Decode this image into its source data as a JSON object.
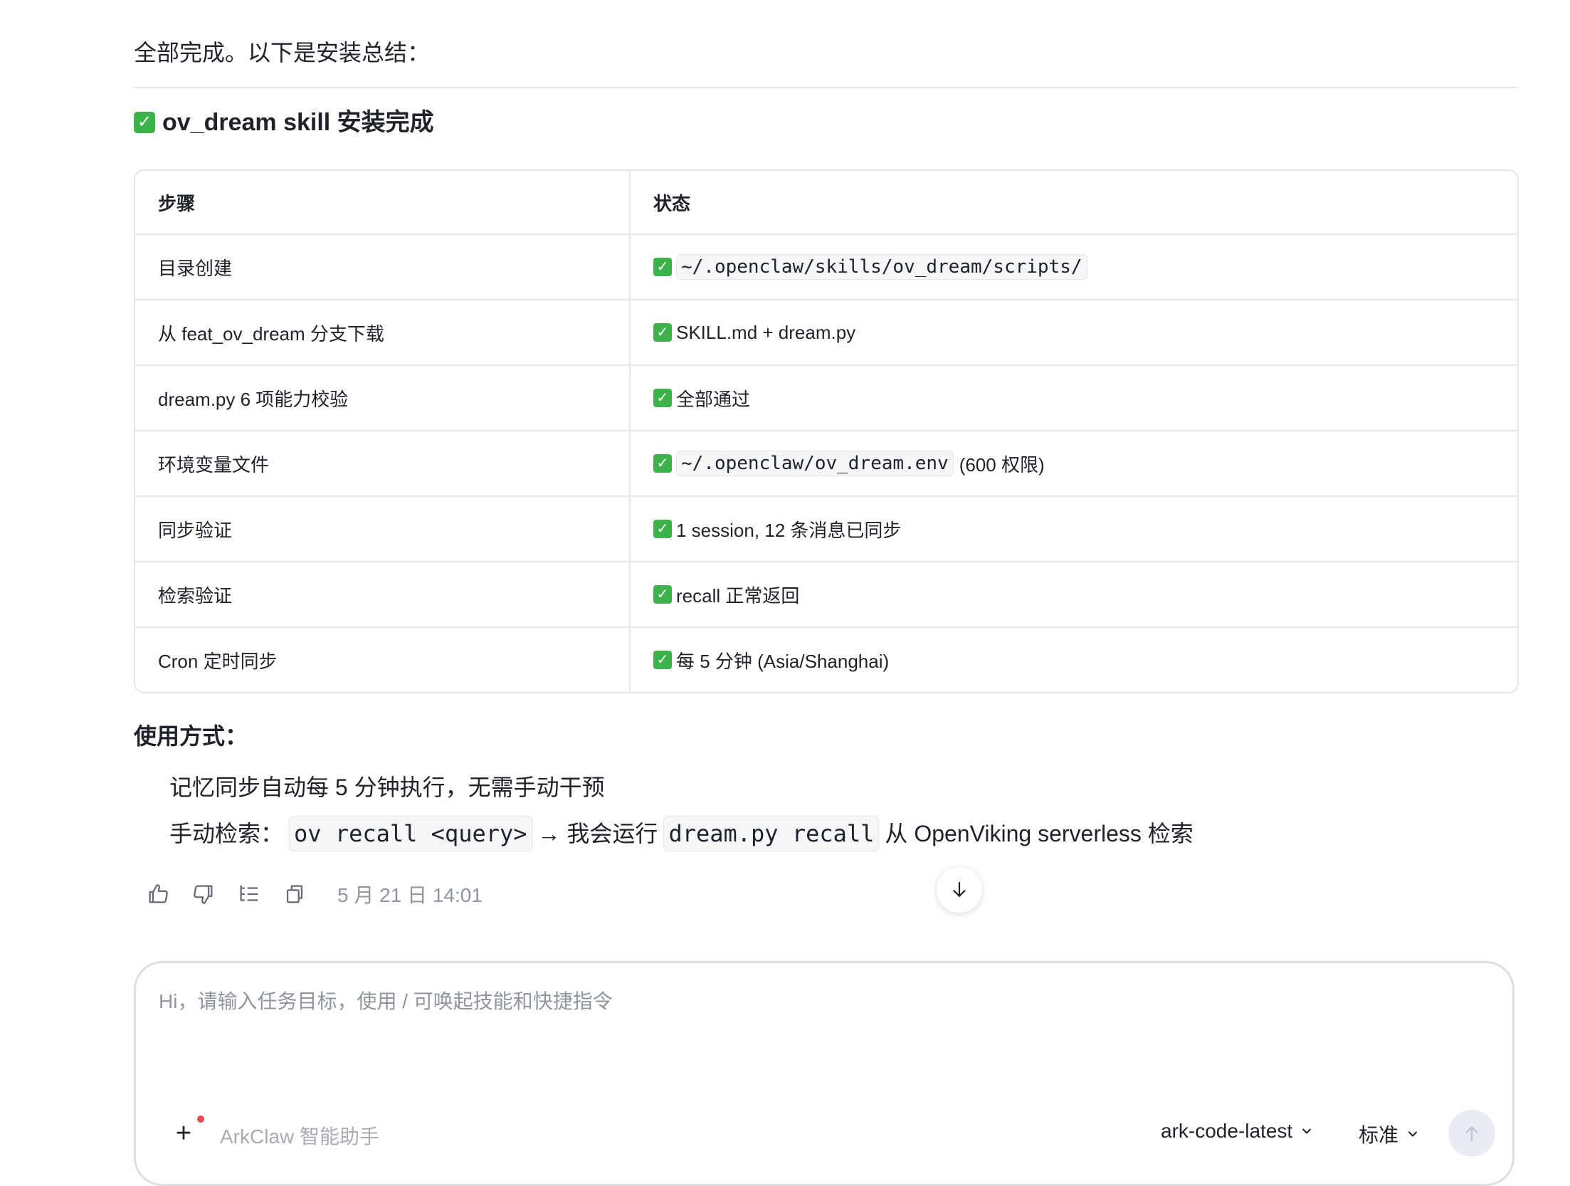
{
  "message": {
    "intro": "全部完成。以下是安装总结：",
    "heading_icon": "check-mark-emoji",
    "heading": "ov_dream skill 安装完成",
    "table": {
      "headers": [
        "步骤",
        "状态"
      ],
      "rows": [
        {
          "step": "目录创建",
          "code": "~/.openclaw/skills/ov_dream/scripts/",
          "text": ""
        },
        {
          "step": "从 feat_ov_dream 分支下载",
          "code": "",
          "text": "SKILL.md + dream.py"
        },
        {
          "step": "dream.py 6 项能力校验",
          "code": "",
          "text": "全部通过"
        },
        {
          "step": "环境变量文件",
          "code": "~/.openclaw/ov_dream.env",
          "text": "(600 权限)"
        },
        {
          "step": "同步验证",
          "code": "",
          "text": "1 session, 12 条消息已同步"
        },
        {
          "step": "检索验证",
          "code": "",
          "text": "recall 正常返回"
        },
        {
          "step": "Cron 定时同步",
          "code": "",
          "text": "每 5 分钟 (Asia/Shanghai)"
        }
      ]
    },
    "usage_title": "使用方式：",
    "usage_line1": "记忆同步自动每 5 分钟执行，无需手动干预",
    "usage_line2": {
      "prefix": "手动检索：",
      "code1": "ov recall <query>",
      "middle": "→ 我会运行",
      "code2": "dream.py recall",
      "suffix": "从 OpenViking serverless 检索"
    },
    "timestamp": "5 月 21 日 14:01"
  },
  "actions": {
    "icons": [
      "thumbs-up-icon",
      "thumbs-down-icon",
      "outline-icon",
      "copy-icon"
    ]
  },
  "composer": {
    "placeholder": "Hi，请输入任务目标，使用 / 可唤起技能和快捷指令",
    "assistant_name": "ArkClaw 智能助手",
    "model": "ark-code-latest",
    "mode": "标准"
  },
  "colors": {
    "check_green": "#3cb34a",
    "border": "#e5e6eb",
    "muted_text": "#8f959e",
    "notify_dot": "#e5484d",
    "send_disabled": "#e8ebf2"
  }
}
